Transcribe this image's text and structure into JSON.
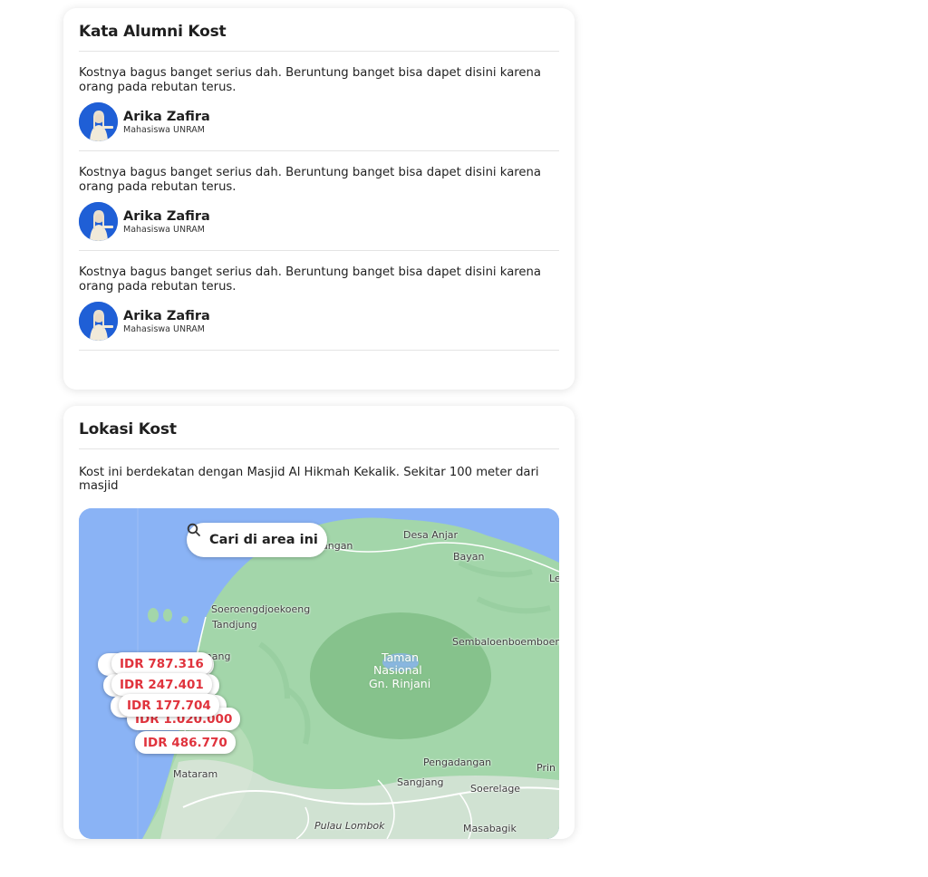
{
  "testimonials_card": {
    "title": "Kata Alumni Kost",
    "items": [
      {
        "quote": "Kostnya bagus banget serius dah. Beruntung banget bisa dapet disini karena orang pada rebutan terus.",
        "name": "Arika Zafira",
        "role": "Mahasiswa UNRAM"
      },
      {
        "quote": "Kostnya bagus banget serius dah. Beruntung banget bisa dapet disini karena orang pada rebutan terus.",
        "name": "Arika Zafira",
        "role": "Mahasiswa UNRAM"
      },
      {
        "quote": "Kostnya bagus banget serius dah. Beruntung banget bisa dapet disini karena orang pada rebutan terus.",
        "name": "Arika Zafira",
        "role": "Mahasiswa UNRAM"
      }
    ]
  },
  "location_card": {
    "title": "Lokasi Kost",
    "description": "Kost ini berdekatan dengan Masjid Al Hikmah Kekalik. Sekitar 100 meter dari masjid",
    "map": {
      "search_label": "Cari di area ini",
      "search_icon": "search-icon",
      "prices": [
        "IDR 787.316",
        "IDR 247.401",
        "IDR 177.704",
        "IDR 1.020.000",
        "IDR 486.770"
      ],
      "places": {
        "desa_anjar": "Desa Anjar",
        "bayan": "Bayan",
        "langan": "angan",
        "soeroeng": "Soeroengdjoekoeng",
        "tandjung": "Tandjung",
        "sembalun": "Sembaloenboemboeng",
        "park": "Taman Nasional Gn. Rinjani",
        "park_l1": "Taman",
        "park_l2": "Nasional",
        "park_l3": "Gn. Rinjani",
        "penang": "enang",
        "pengadangan": "Pengadangan",
        "prin": "Prin",
        "mataram": "Mataram",
        "sangjang": "Sangjang",
        "soerelage": "Soerelage",
        "pulau_lombok": "Pulau Lombok",
        "masabagik": "Masabagik",
        "le": "Le"
      },
      "colors": {
        "water": "#8ab3f5",
        "land": "#9fd3a6",
        "park": "#84c08a",
        "price_text": "#e0333d"
      }
    }
  }
}
